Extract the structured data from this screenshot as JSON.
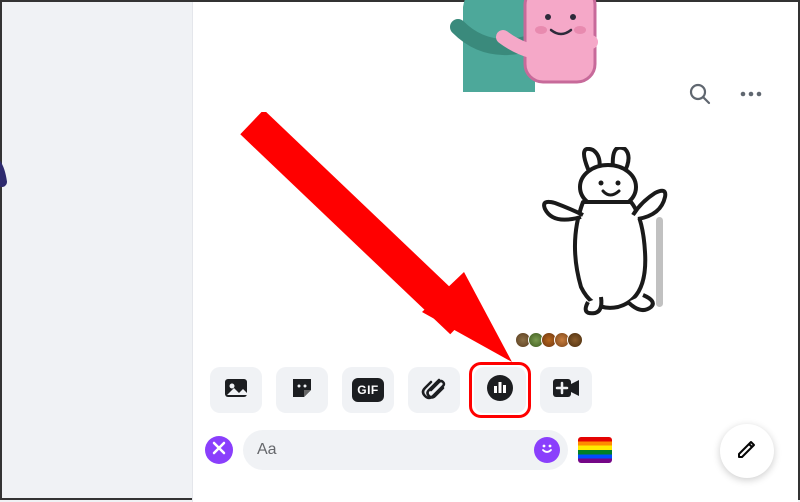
{
  "composer": {
    "placeholder": "Aa"
  },
  "attachments": {
    "gif_label": "GIF"
  },
  "icons": {
    "photo": "photo-icon",
    "sticker": "sticker-icon",
    "gif": "gif-icon",
    "attachment": "paperclip-icon",
    "poll": "poll-icon",
    "video": "video-plus-icon",
    "close": "close-icon",
    "smiley": "smiley-icon",
    "search": "search-icon",
    "more": "more-icon",
    "compose": "compose-icon"
  },
  "stickers": {
    "left": "waving-blob-character",
    "top": "hugging-characters",
    "bunny": "dancing-bunny-outline"
  },
  "colors": {
    "accent": "#8a3ffc",
    "highlight": "#ff0000",
    "bg": "#f0f2f5"
  },
  "read_receipts_count": 5
}
